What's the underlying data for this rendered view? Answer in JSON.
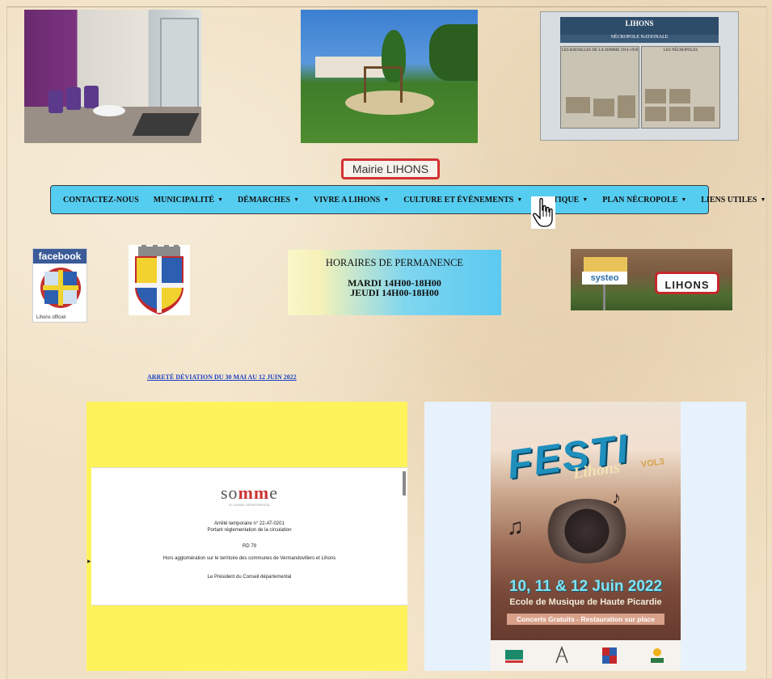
{
  "header": {
    "site_label": "Mairie LIHONS"
  },
  "photos": {
    "panel_title": "LIHONS",
    "panel_subtitle": "NÉCROPOLE NATIONALE",
    "panel_left_caption": "LES BATAILLES DE LA SOMME 1914-1918",
    "panel_right_caption": "LES NÉCROPOLES"
  },
  "nav": {
    "items": [
      {
        "label": "CONTACTEZ-NOUS",
        "dropdown": false
      },
      {
        "label": "MUNICIPALITÉ",
        "dropdown": true
      },
      {
        "label": "DÉMARCHES",
        "dropdown": true
      },
      {
        "label": "VIVRE A LIHONS",
        "dropdown": true
      },
      {
        "label": "CULTURE ET ÉVÈNEMENTS",
        "dropdown": true
      },
      {
        "label": "PRATIQUE",
        "dropdown": true
      },
      {
        "label": "PLAN NÈCROPOLE",
        "dropdown": true
      },
      {
        "label": "LIENS UTILES",
        "dropdown": true
      }
    ],
    "caret": "▼"
  },
  "facebook": {
    "brand": "facebook",
    "caption": "Lihons officiel"
  },
  "hours": {
    "title": "HORAIRES DE PERMANENCE",
    "line1": "MARDI 14H00-18H00",
    "line2": "JEUDI 14H00-18H00"
  },
  "systeo": {
    "sign": "systeo",
    "town_sign": "LIHONS"
  },
  "announcement": {
    "link_text": "ARRETÉ DÉVIATION DU 30 MAI AU 12 JUIN 2022"
  },
  "document": {
    "logo_part1": "so",
    "logo_part2": "mm",
    "logo_part3": "e",
    "logo_sub": "LE CONSEIL DÉPARTEMENTAL",
    "line1": "Arrêté temporaire n° 22-AT-0201",
    "line2": "Portant réglementation de la circulation",
    "line3": "RD 79",
    "line4": "Hors agglomération sur le territoire des communes de Vermandovillers et Lihons",
    "line5": "Le Président du Conseil départemental"
  },
  "poster": {
    "title": "FESTI",
    "subtitle": "Lihons",
    "vol": "VOL3",
    "date": "10, 11 & 12 Juin 2022",
    "school": "Ecole de Musique de Haute Picardie",
    "concerts": "Concerts Gratuits - Restauration sur place"
  },
  "colors": {
    "nav_bg": "#55cdf0",
    "mairie_border": "#d23232",
    "link": "#1a3fc7",
    "doc_bg": "#fff35c",
    "poster_panel_bg": "#e8f2fc"
  },
  "icons": {
    "cursor": "hand-pointer-icon",
    "dropdown": "caret-down-icon"
  }
}
